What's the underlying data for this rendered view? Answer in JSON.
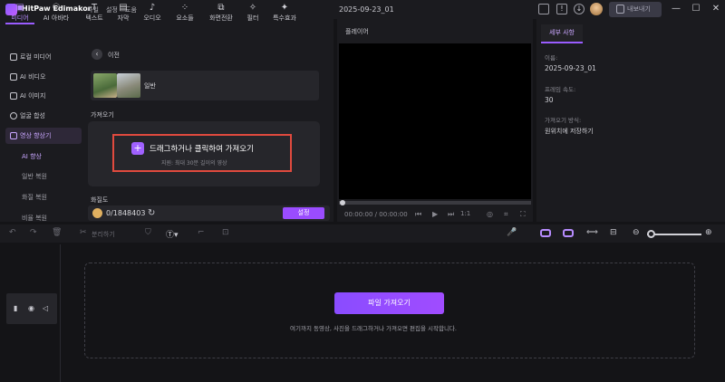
{
  "app": {
    "title": "HitPaw Edimakor",
    "menu": [
      "파일",
      "설정",
      "도움"
    ],
    "project_name": "2025-09-23_01",
    "export_label": "내보내기",
    "window_controls": [
      "—",
      "☐",
      "✕"
    ]
  },
  "tabs": [
    {
      "label": "미디어",
      "icon": "media-icon"
    },
    {
      "label": "AI 아바타",
      "icon": "avatar-icon"
    },
    {
      "label": "텍스트",
      "icon": "text-icon"
    },
    {
      "label": "자막",
      "icon": "subtitle-icon"
    },
    {
      "label": "오디오",
      "icon": "audio-icon"
    },
    {
      "label": "요소들",
      "icon": "elements-icon"
    },
    {
      "label": "화면전환",
      "icon": "transition-icon"
    },
    {
      "label": "필터",
      "icon": "filter-icon"
    },
    {
      "label": "특수효과",
      "icon": "effects-icon"
    }
  ],
  "sidebar": {
    "items": [
      {
        "label": "로컬 미디어"
      },
      {
        "label": "AI 비디오"
      },
      {
        "label": "AI 이미지"
      },
      {
        "label": "얼굴 합성"
      },
      {
        "label": "영상 향상기"
      }
    ],
    "subitems": [
      "AI 향상",
      "일반 복원",
      "화질 복원",
      "비율 복원"
    ]
  },
  "media": {
    "back_label": "이전",
    "general_label": "일반",
    "import_title": "가져오기",
    "import_text": "드래그하거나 클릭하여 가져오기",
    "import_sub": "지원: 최대 30분 길이의 영상",
    "quality_title": "화질도",
    "credits": "0/1848403",
    "settings_label": "설정"
  },
  "player": {
    "title": "플레이어",
    "timecode": "00:00:00 / 00:00:00",
    "speed": "1:1"
  },
  "details": {
    "tab_label": "세부 사항",
    "name_label": "이름:",
    "name_value": "2025-09-23_01",
    "fps_label": "프레임 속도:",
    "fps_value": "30",
    "import_mode_label": "가져오기 방식:",
    "import_mode_value": "원위치에 저장하기"
  },
  "timeline": {
    "split_label": "분리하기",
    "import_file_label": "파일 가져오기",
    "drop_hint": "여기까지 동영상, 사진을 드래그하거나 가져오면 편집을 시작합니다."
  },
  "colors": {
    "accent": "#9a5cff",
    "highlight_border": "#e04a3e",
    "background": "#141417",
    "panel": "#1b1b1f"
  }
}
